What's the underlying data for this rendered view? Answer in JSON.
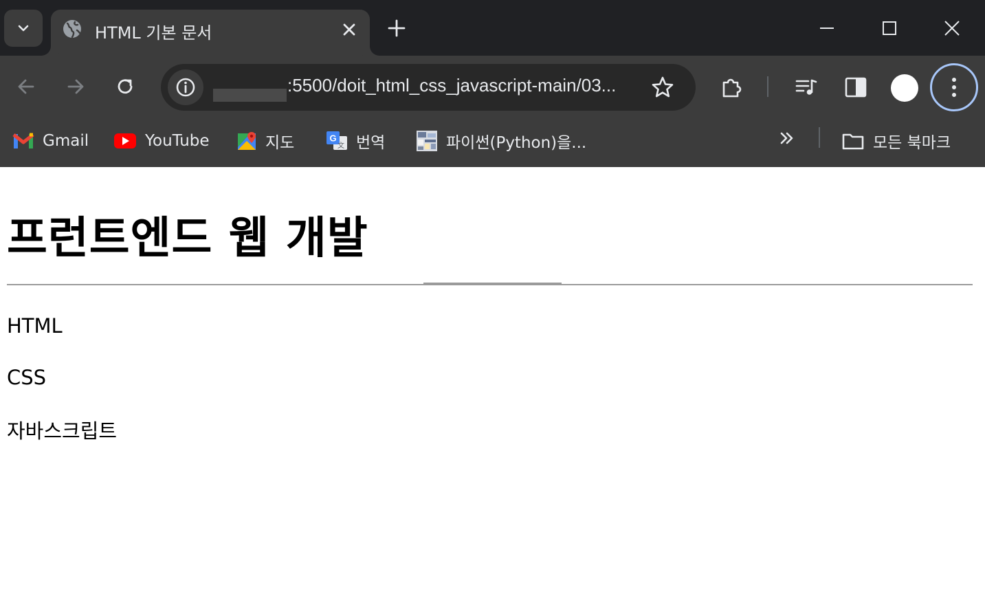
{
  "browser": {
    "tab": {
      "title": "HTML 기본 문서"
    },
    "address_bar": {
      "url": ":5500/doit_html_css_javascript-main/03..."
    },
    "bookmarks": [
      {
        "label": "Gmail",
        "icon": "gmail-icon"
      },
      {
        "label": "YouTube",
        "icon": "youtube-icon"
      },
      {
        "label": "지도",
        "icon": "maps-icon"
      },
      {
        "label": "번역",
        "icon": "translate-icon"
      },
      {
        "label": "파이썬(Python)을...",
        "icon": "python-favicon"
      }
    ],
    "all_bookmarks_label": "모든 북마크",
    "colors": {
      "frame": "#202124",
      "toolbar": "#3c3c3c",
      "omnibox": "#282828",
      "text": "#e8eaed",
      "focus_ring": "#a8c7fa"
    }
  },
  "page": {
    "heading": "프런트엔드 웹 개발",
    "paragraphs": [
      "HTML",
      "CSS",
      "자바스크립트"
    ]
  }
}
